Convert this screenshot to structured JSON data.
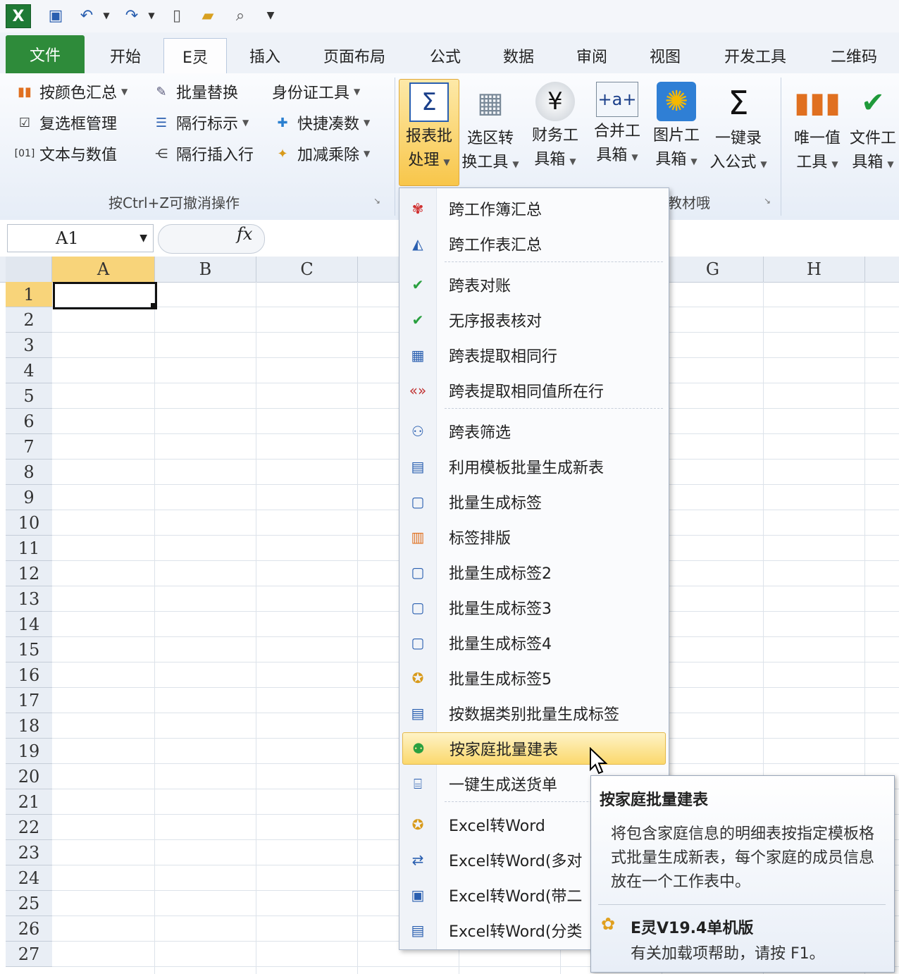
{
  "qat": {
    "excel_logo": "X"
  },
  "tabs": [
    {
      "label": "文件"
    },
    {
      "label": "开始"
    },
    {
      "label": "E灵"
    },
    {
      "label": "插入"
    },
    {
      "label": "页面布局"
    },
    {
      "label": "公式"
    },
    {
      "label": "数据"
    },
    {
      "label": "审阅"
    },
    {
      "label": "视图"
    },
    {
      "label": "开发工具"
    },
    {
      "label": "二维码"
    }
  ],
  "ribbon": {
    "small_buttons": [
      {
        "label": "按颜色汇总",
        "icon": "bar-chart-icon"
      },
      {
        "label": "批量替换",
        "icon": "replace-icon"
      },
      {
        "label": "身份证工具"
      },
      {
        "label": "复选框管理",
        "icon": "checkbox-icon"
      },
      {
        "label": "隔行标示",
        "icon": "rows-icon"
      },
      {
        "label": "快捷凑数",
        "icon": "plus-icon"
      },
      {
        "label": "文本与数值",
        "icon": "text-number-icon"
      },
      {
        "label": "隔行插入行",
        "icon": "insert-row-icon"
      },
      {
        "label": "加减乘除",
        "icon": "calc-icon"
      }
    ],
    "group1_label": "按Ctrl+Z可撤消操作",
    "group2_label": "教材哦",
    "big_buttons": [
      {
        "line1": "报表批",
        "line2": "处理",
        "icon": "sigma-table-icon"
      },
      {
        "line1": "选区转",
        "line2": "换工具",
        "icon": "grid-hand-icon"
      },
      {
        "line1": "财务工",
        "line2": "具箱",
        "icon": "yen-icon"
      },
      {
        "line1": "合并工",
        "line2": "具箱",
        "icon": "merge-icon"
      },
      {
        "line1": "图片工",
        "line2": "具箱",
        "icon": "sunflower-icon"
      },
      {
        "line1": "一键录",
        "line2": "入公式",
        "icon": "sigma-icon"
      },
      {
        "line1": "唯一值",
        "line2": "工具",
        "icon": "bar-chart-icon"
      },
      {
        "line1": "文件工",
        "line2": "具箱",
        "icon": "excel-check-icon"
      }
    ]
  },
  "formula_bar": {
    "name_box": "A1",
    "fx": "fx"
  },
  "columns": [
    "A",
    "B",
    "C",
    "G",
    "H"
  ],
  "rows": [
    "1",
    "2",
    "3",
    "4",
    "5",
    "6",
    "7",
    "8",
    "9",
    "10",
    "11",
    "12",
    "13",
    "14",
    "15",
    "16",
    "17",
    "18",
    "19",
    "20",
    "21",
    "22",
    "23",
    "24",
    "25",
    "26",
    "27"
  ],
  "menu": {
    "items": [
      {
        "label": "跨工作簿汇总",
        "icon": "workbooks-icon"
      },
      {
        "label": "跨工作表汇总",
        "icon": "sheets-icon"
      },
      {
        "label": "跨表对账",
        "icon": "check-icon"
      },
      {
        "label": "无序报表核对",
        "icon": "check-icon"
      },
      {
        "label": "跨表提取相同行",
        "icon": "table-icon"
      },
      {
        "label": "跨表提取相同值所在行",
        "icon": "abc-icon"
      },
      {
        "label": "跨表筛选",
        "icon": "binoculars-icon"
      },
      {
        "label": "利用模板批量生成新表",
        "icon": "template-icon"
      },
      {
        "label": "批量生成标签",
        "icon": "label-icon"
      },
      {
        "label": "标签排版",
        "icon": "layout-icon"
      },
      {
        "label": "批量生成标签2",
        "icon": "label-icon"
      },
      {
        "label": "批量生成标签3",
        "icon": "label-icon"
      },
      {
        "label": "批量生成标签4",
        "icon": "label-icon"
      },
      {
        "label": "批量生成标签5",
        "icon": "star-card-icon"
      },
      {
        "label": "按数据类别批量生成标签",
        "icon": "list-icon"
      },
      {
        "label": "按家庭批量建表",
        "icon": "family-icon"
      },
      {
        "label": "一键生成送货单",
        "icon": "form-icon"
      },
      {
        "label": "Excel转Word",
        "icon": "star-card-icon"
      },
      {
        "label": "Excel转Word(多对",
        "icon": "convert-icon"
      },
      {
        "label": "Excel转Word(带二",
        "icon": "doc-icon"
      },
      {
        "label": "Excel转Word(分类",
        "icon": "doc-list-icon"
      }
    ]
  },
  "tooltip": {
    "title": "按家庭批量建表",
    "body": "将包含家庭信息的明细表按指定模板格式批量生成新表，每个家庭的成员信息放在一个工作表中。",
    "footer": "E灵V19.4单机版",
    "help": "有关加载项帮助，请按 F1。"
  }
}
